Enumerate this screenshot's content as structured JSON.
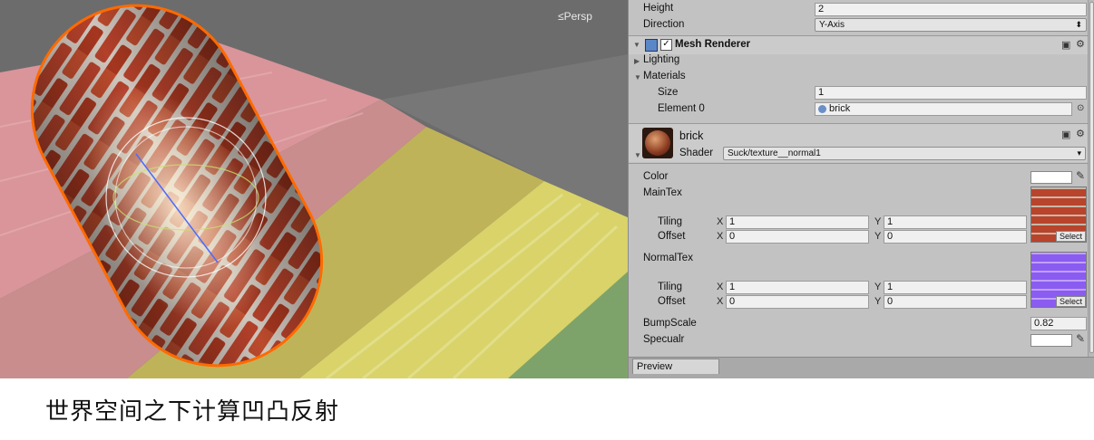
{
  "scene": {
    "view_label": "Persp"
  },
  "inspector": {
    "height_label": "Height",
    "height_value": "2",
    "direction_label": "Direction",
    "direction_value": "Y-Axis",
    "mesh_renderer": {
      "title": "Mesh Renderer",
      "enabled": true,
      "lighting_label": "Lighting",
      "materials_label": "Materials",
      "size_label": "Size",
      "size_value": "1",
      "element0_label": "Element 0",
      "element0_value": "brick"
    },
    "material": {
      "name": "brick",
      "shader_label": "Shader",
      "shader_value": "Suck/texture__normal1",
      "color_label": "Color",
      "maintex_label": "MainTex",
      "main_tiling_label": "Tiling",
      "main_tiling_x": "1",
      "main_tiling_y": "1",
      "main_offset_label": "Offset",
      "main_offset_x": "0",
      "main_offset_y": "0",
      "normaltex_label": "NormalTex",
      "normal_tiling_label": "Tiling",
      "normal_tiling_x": "1",
      "normal_tiling_y": "1",
      "normal_offset_label": "Offset",
      "normal_offset_x": "0",
      "normal_offset_y": "0",
      "bumpscale_label": "BumpScale",
      "bumpscale_value": "0.82",
      "specular_label": "Specualr",
      "select_label": "Select",
      "x_label": "X",
      "y_label": "Y"
    },
    "preview_tab": "Preview"
  },
  "caption": "世界空间之下计算凹凸反射",
  "colors": {
    "selection_outline": "#ff6a00",
    "inspector_bg": "#c2c2c2",
    "brick": "#b2402a",
    "mortar": "#cfc6bd",
    "normal_map": "#8a5cf0"
  }
}
